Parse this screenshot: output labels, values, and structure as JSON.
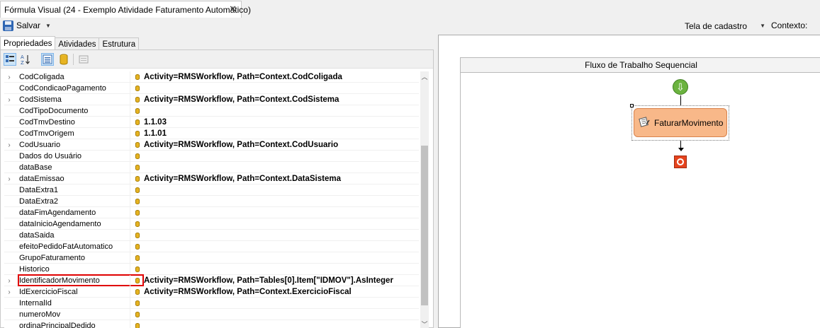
{
  "document_tab": {
    "title": "Fórmula Visual (24 - Exemplo Atividade Faturamento Automático)",
    "close": "✕"
  },
  "toolbar": {
    "save_label": "Salvar",
    "view_select": "Tela de cadastro",
    "context_label": "Contexto:"
  },
  "panel_tabs": [
    "Propriedades",
    "Atividades",
    "Estrutura"
  ],
  "properties": [
    {
      "name": "CodColigada",
      "value": "Activity=RMSWorkflow, Path=Context.CodColigada",
      "expandable": true
    },
    {
      "name": "CodCondicaoPagamento",
      "value": "",
      "expandable": false
    },
    {
      "name": "CodSistema",
      "value": "Activity=RMSWorkflow, Path=Context.CodSistema",
      "expandable": true
    },
    {
      "name": "CodTipoDocumento",
      "value": "",
      "expandable": false
    },
    {
      "name": "CodTmvDestino",
      "value": "1.1.03",
      "expandable": false
    },
    {
      "name": "CodTmvOrigem",
      "value": "1.1.01",
      "expandable": false
    },
    {
      "name": "CodUsuario",
      "value": "Activity=RMSWorkflow, Path=Context.CodUsuario",
      "expandable": true
    },
    {
      "name": "Dados do Usuário",
      "value": "",
      "expandable": false
    },
    {
      "name": "dataBase",
      "value": "",
      "expandable": false
    },
    {
      "name": "dataEmissao",
      "value": "Activity=RMSWorkflow, Path=Context.DataSistema",
      "expandable": true
    },
    {
      "name": "DataExtra1",
      "value": "",
      "expandable": false
    },
    {
      "name": "DataExtra2",
      "value": "",
      "expandable": false
    },
    {
      "name": "dataFimAgendamento",
      "value": "",
      "expandable": false
    },
    {
      "name": "dataInicioAgendamento",
      "value": "",
      "expandable": false
    },
    {
      "name": "dataSaida",
      "value": "",
      "expandable": false
    },
    {
      "name": "efeitoPedidoFatAutomatico",
      "value": "",
      "expandable": false
    },
    {
      "name": "GrupoFaturamento",
      "value": "",
      "expandable": false
    },
    {
      "name": "Historico",
      "value": "",
      "expandable": false
    },
    {
      "name": "IdentificadorMovimento",
      "value": "Activity=RMSWorkflow, Path=Tables[0].Item[\"IDMOV\"].AsInteger",
      "expandable": true,
      "highlighted": true
    },
    {
      "name": "IdExercicioFiscal",
      "value": "Activity=RMSWorkflow, Path=Context.ExercicioFiscal",
      "expandable": true
    },
    {
      "name": "InternalId",
      "value": "",
      "expandable": false
    },
    {
      "name": "numeroMov",
      "value": "",
      "expandable": false
    },
    {
      "name": "ordinaPrincipalDedido",
      "value": "",
      "expandable": false
    }
  ],
  "designer": {
    "header": "Fluxo de Trabalho Sequencial",
    "activity_label": "FaturarMovimento"
  }
}
